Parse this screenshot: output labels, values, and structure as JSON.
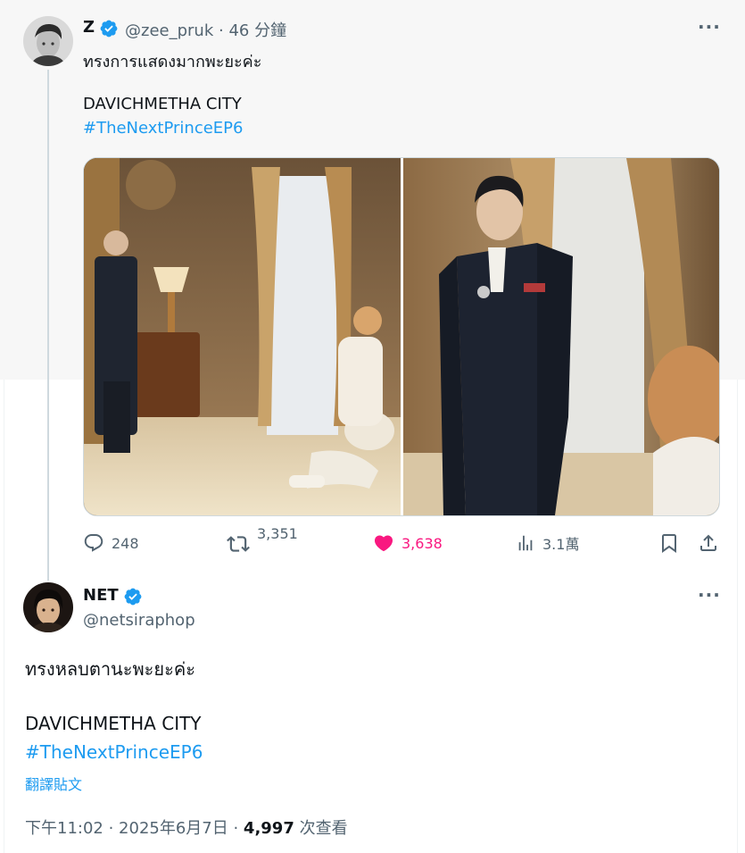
{
  "tweet1": {
    "author_name": "Z",
    "handle": "@zee_pruk",
    "separator": " · ",
    "time_ago": "46 分鐘",
    "text_line1": "ทรงการแสดงมากพะยะค่ะ",
    "text_line2": "DAVICHMETHA CITY",
    "hashtag": "#TheNextPrinceEP6",
    "more": "···",
    "actions": {
      "replies": "248",
      "retweets": "3,351",
      "likes": "3,638",
      "views": "3.1萬"
    },
    "liked": true
  },
  "tweet2": {
    "author_name": "NET",
    "handle": "@netsiraphop",
    "more": "···",
    "text_line1": "ทรงหลบตานะพะยะค่ะ",
    "text_line2": "DAVICHMETHA CITY",
    "hashtag": "#TheNextPrinceEP6",
    "translate": "翻譯貼文",
    "timestamp": "下午11:02 · 2025年6月7日 · ",
    "view_count": "4,997",
    "view_label": " 次查看"
  },
  "colors": {
    "accent": "#1d9bf0",
    "like": "#f91880",
    "secondary_text": "#536471",
    "verified": "#1d9bf0"
  },
  "icons": [
    "verified-badge-icon",
    "more-icon",
    "reply-icon",
    "retweet-icon",
    "heart-icon",
    "views-icon",
    "bookmark-icon",
    "share-icon"
  ]
}
